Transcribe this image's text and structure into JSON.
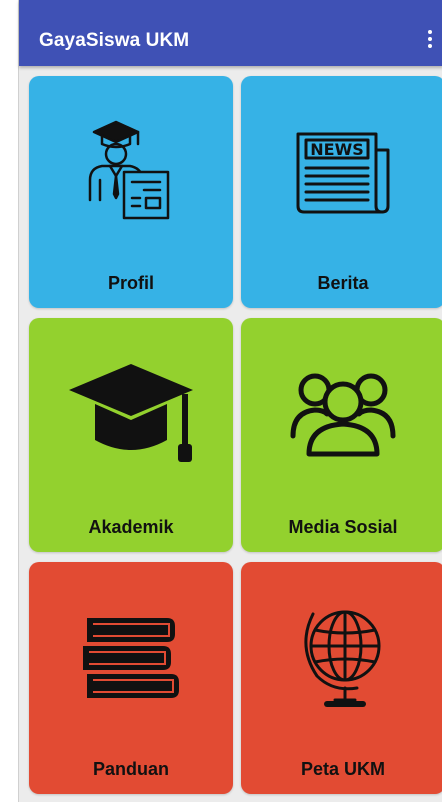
{
  "app": {
    "title": "GayaSiswa UKM",
    "menu_icon": "overflow-menu-icon"
  },
  "colors": {
    "appbar": "#3f51b5",
    "tile_blue": "#36b2e6",
    "tile_green": "#93d12e",
    "tile_red": "#e24b33",
    "background": "#ececec"
  },
  "menu": {
    "items": [
      {
        "label": "Profil",
        "icon": "graduate-profile-icon"
      },
      {
        "label": "Berita",
        "icon": "newspaper-icon"
      },
      {
        "label": "Akademik",
        "icon": "graduation-cap-icon"
      },
      {
        "label": "Media Sosial",
        "icon": "social-group-icon"
      },
      {
        "label": "Panduan",
        "icon": "books-icon"
      },
      {
        "label": "Peta UKM",
        "icon": "globe-icon"
      }
    ]
  }
}
